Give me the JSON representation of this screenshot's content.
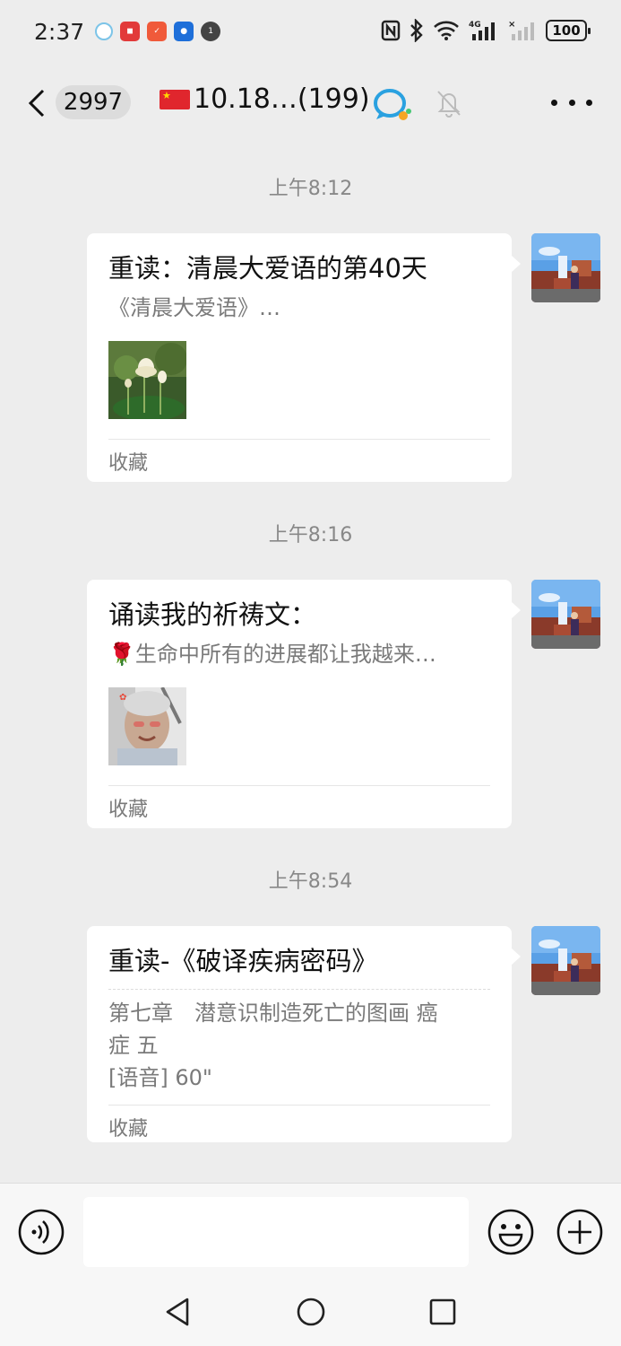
{
  "status_bar": {
    "time": "2:37",
    "battery": "100",
    "network_label": "4G"
  },
  "header": {
    "unread_count": "2997",
    "title": "10.18…(199)"
  },
  "messages": [
    {
      "time": "上午8:12",
      "title": "重读：清晨大爱语的第40天",
      "desc": "《清晨大爱语》…",
      "footer": "收藏",
      "thumb_icon": "lotus-photo"
    },
    {
      "time": "上午8:16",
      "title": "诵读我的祈祷文：",
      "desc": "🌹生命中所有的进展都让我越来…",
      "footer": "收藏",
      "thumb_icon": "portrait-photo"
    },
    {
      "time": "上午8:54",
      "title": "重读-《破译疾病密码》",
      "desc_line1": "第七章　潜意识制造死亡的图画 癌",
      "desc_line2": "症 五",
      "desc_line3": "[语音] 60\"",
      "footer": "收藏"
    }
  ],
  "input": {
    "value": "",
    "placeholder": ""
  },
  "colors": {
    "background": "#ededed",
    "bubble": "#ffffff",
    "muted_text": "#7a7a7a",
    "flag_red": "#e0262d"
  }
}
